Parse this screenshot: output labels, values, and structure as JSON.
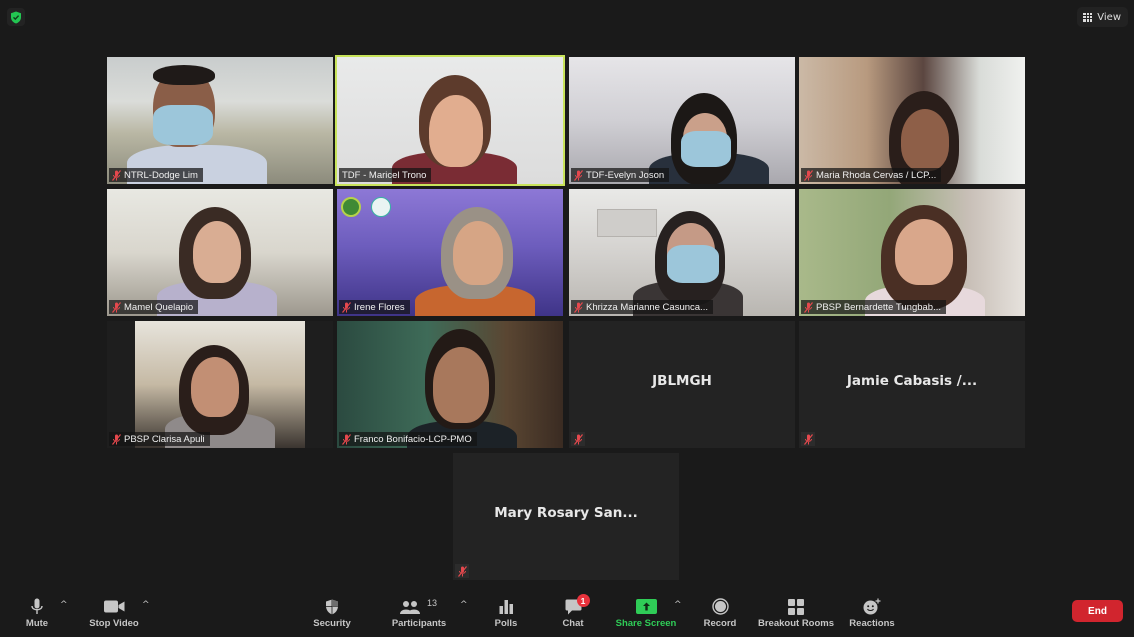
{
  "topbar": {
    "encryption_icon": "shield-check-icon",
    "view_label": "View",
    "view_icon": "grid-icon",
    "security_color": "#23c552"
  },
  "gallery": {
    "active_speaker_color": "#c8e35a",
    "muted_icon": "mic-off-icon",
    "muted_color": "#e5484d",
    "participants": [
      {
        "name": "NTRL-Dodge Lim",
        "video": true,
        "muted": true,
        "active": false
      },
      {
        "name": "TDF - Maricel Trono",
        "video": true,
        "muted": false,
        "active": true
      },
      {
        "name": "TDF-Evelyn Joson",
        "video": true,
        "muted": true,
        "active": false
      },
      {
        "name": "Maria Rhoda Cervas / LCP...",
        "video": true,
        "muted": true,
        "active": false
      },
      {
        "name": "Mamel Quelapio",
        "video": true,
        "muted": true,
        "active": false
      },
      {
        "name": "Irene Flores",
        "video": true,
        "muted": true,
        "active": false
      },
      {
        "name": "Khrizza Marianne Casunca...",
        "video": true,
        "muted": true,
        "active": false
      },
      {
        "name": "PBSP Bernardette Tungbab...",
        "video": true,
        "muted": true,
        "active": false
      },
      {
        "name": "PBSP Clarisa Apuli",
        "video": true,
        "muted": true,
        "active": false
      },
      {
        "name": "Franco Bonifacio-LCP-PMO",
        "video": true,
        "muted": true,
        "active": false
      },
      {
        "name": "JBLMGH",
        "video": false,
        "muted": true,
        "active": false
      },
      {
        "name": "Jamie Cabasis /...",
        "video": false,
        "muted": true,
        "active": false
      },
      {
        "name": "Mary Rosary San...",
        "video": false,
        "muted": true,
        "active": false
      }
    ]
  },
  "toolbar": {
    "mute": {
      "label": "Mute",
      "icon": "microphone-icon"
    },
    "stop_video": {
      "label": "Stop Video",
      "icon": "video-camera-icon"
    },
    "security": {
      "label": "Security",
      "icon": "shield-icon"
    },
    "participants": {
      "label": "Participants",
      "icon": "participants-icon",
      "count": "13"
    },
    "polls": {
      "label": "Polls",
      "icon": "bar-chart-icon"
    },
    "chat": {
      "label": "Chat",
      "icon": "chat-bubble-icon",
      "badge": "1"
    },
    "share_screen": {
      "label": "Share Screen",
      "icon": "share-arrow-icon",
      "color": "#2fcc57"
    },
    "record": {
      "label": "Record",
      "icon": "record-icon"
    },
    "breakout_rooms": {
      "label": "Breakout Rooms",
      "icon": "breakout-grid-icon"
    },
    "reactions": {
      "label": "Reactions",
      "icon": "smiley-plus-icon"
    },
    "end": {
      "label": "End",
      "color": "#d1252e"
    }
  }
}
